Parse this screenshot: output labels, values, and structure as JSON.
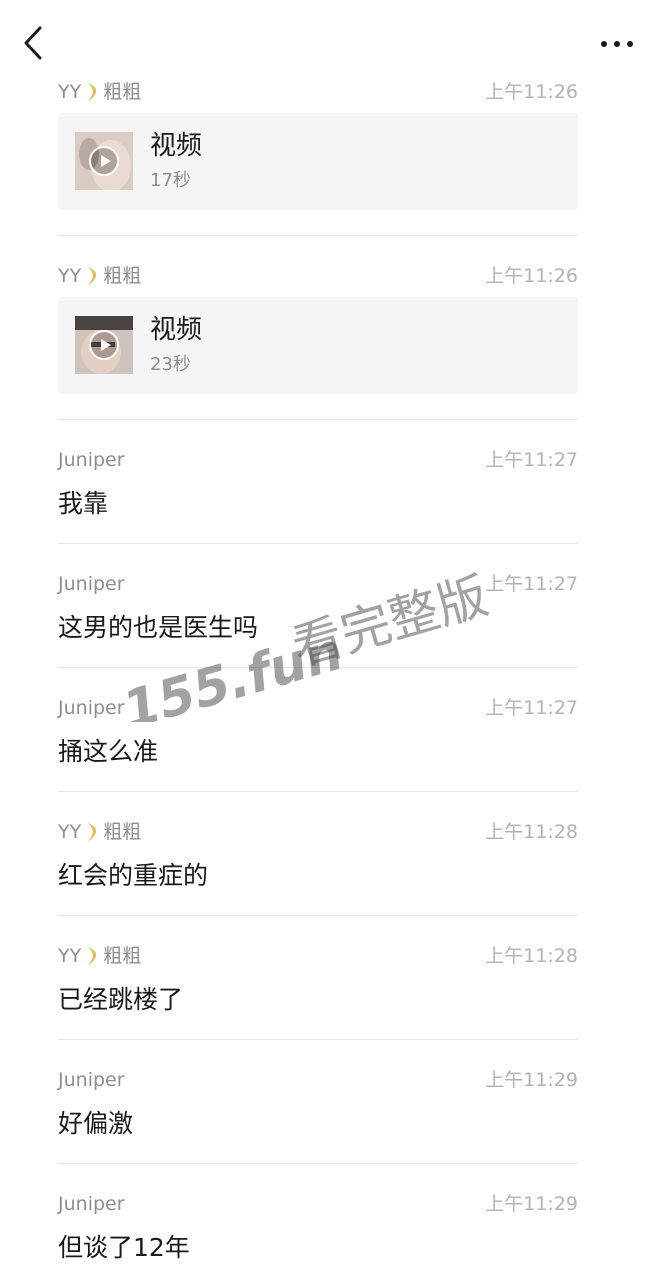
{
  "header": {
    "back_icon": "chevron-left-icon",
    "more_icon": "more-dots-icon"
  },
  "messages": [
    {
      "type": "video",
      "sender": "YY",
      "sender_emoji": true,
      "time": "上午11:26",
      "title": "视频",
      "duration": "17秒"
    },
    {
      "type": "video",
      "sender": "YY",
      "sender_emoji": true,
      "time": "上午11:26",
      "title": "视频",
      "duration": "23秒"
    },
    {
      "type": "text",
      "sender": "Juniper",
      "time": "上午11:27",
      "text": "我靠"
    },
    {
      "type": "text",
      "sender": "Juniper",
      "time": "上午11:27",
      "text": "这男的也是医生吗"
    },
    {
      "type": "text",
      "sender": "Juniper",
      "time": "上午11:27",
      "text": "捅这么准"
    },
    {
      "type": "text",
      "sender": "YY",
      "sender_emoji": true,
      "time": "上午11:28",
      "text": "红会的重症的"
    },
    {
      "type": "text",
      "sender": "YY",
      "sender_emoji": true,
      "time": "上午11:28",
      "text": "已经跳楼了"
    },
    {
      "type": "text",
      "sender": "Juniper",
      "time": "上午11:29",
      "text": "好偏激"
    },
    {
      "type": "text",
      "sender": "Juniper",
      "time": "上午11:29",
      "text": "但谈了12年"
    }
  ],
  "sender_suffix": "粗粗",
  "watermark": {
    "domain": "155.fun",
    "slogan": "看完整版"
  },
  "colors": {
    "background": "#ffffff",
    "card": "#f5f5f5",
    "divider": "#e6e6e6",
    "sender": "#8e8e8e",
    "time": "#b3b3b3",
    "text": "#1a1a1a",
    "emoji": "#e8b84a"
  }
}
